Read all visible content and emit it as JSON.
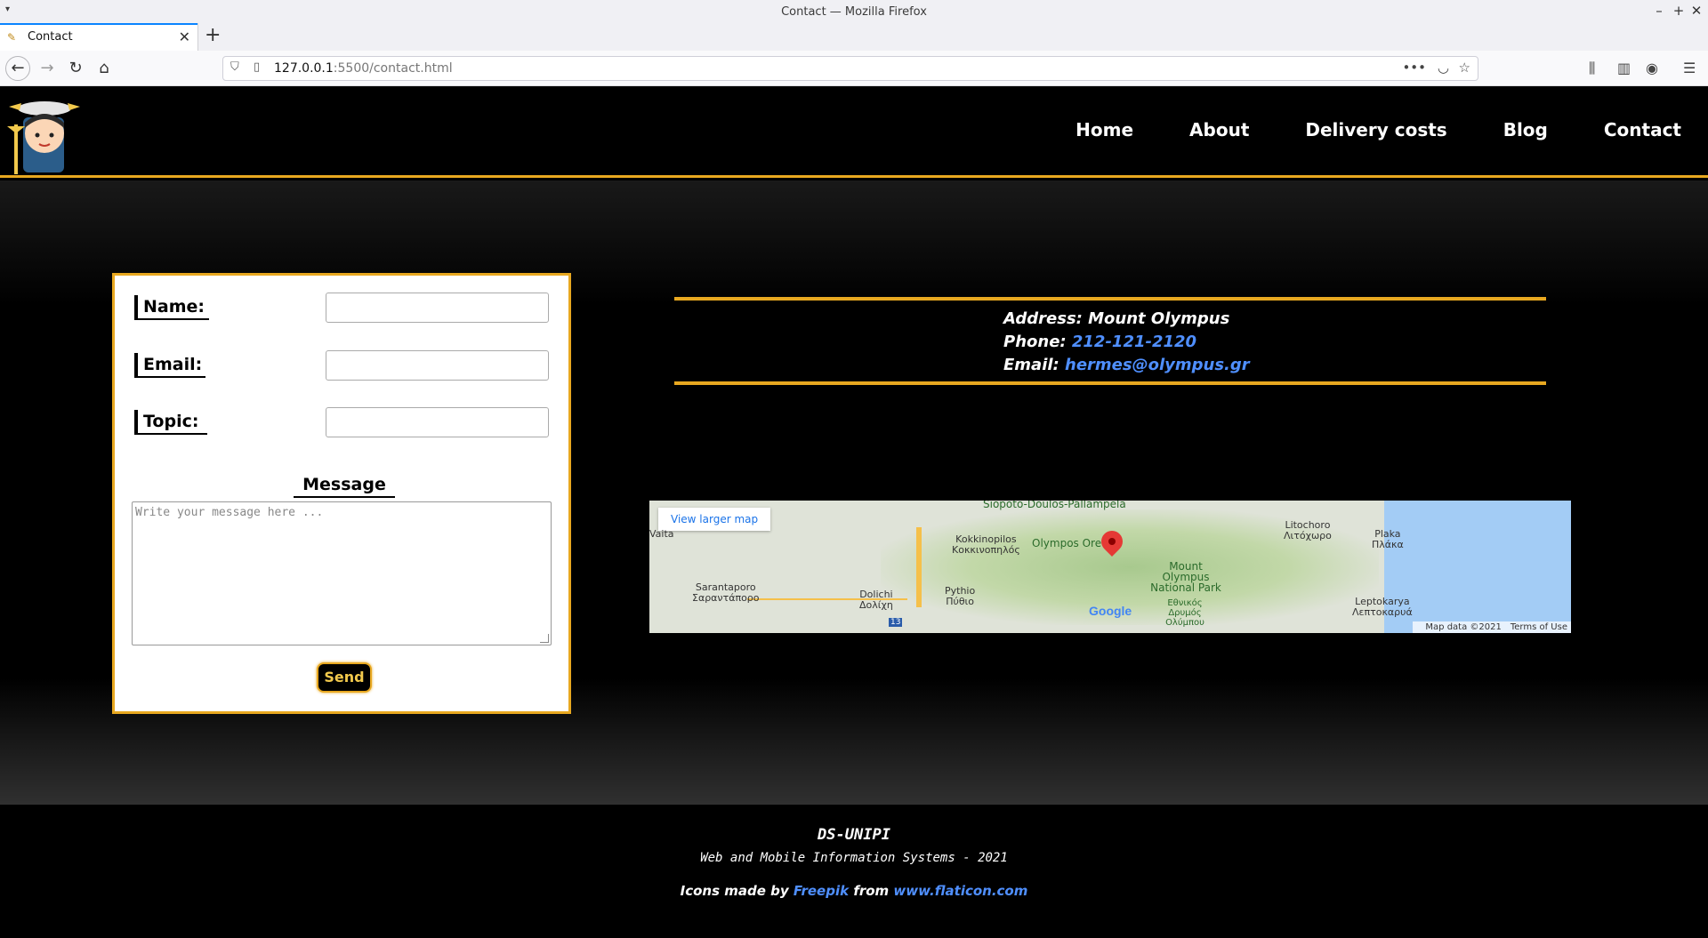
{
  "browser": {
    "window_title": "Contact — Mozilla Firefox",
    "tab_title": "Contact",
    "url_host": "127.0.0.1",
    "url_rest": ":5500/contact.html"
  },
  "site": {
    "nav": [
      "Home",
      "About",
      "Delivery costs",
      "Blog",
      "Contact"
    ]
  },
  "form": {
    "name_label": "Name:",
    "email_label": "Email:",
    "topic_label": "Topic:",
    "message_title": "Message",
    "message_placeholder": "Write your message here ...",
    "send_label": "Send"
  },
  "contact": {
    "address_label": "Address:",
    "address_value": "Mount Olympus",
    "phone_label": "Phone:",
    "phone_value": "212-121-2120",
    "email_label": "Email:",
    "email_value": "hermes@olympus.gr"
  },
  "map": {
    "view_larger": "View larger map",
    "labels": {
      "siopoto": "Siopoto-Doulos-Pallampela",
      "vaita": "Vaita",
      "kokkinopilos": "Kokkinopilos",
      "kokkinopilos_gr": "Κοκκινοπηλός",
      "olympos_ore": "Olympos Ore",
      "litochoro": "Litochoro",
      "litochoro_gr": "Λιτόχωρο",
      "plaka": "Plaka",
      "plaka_gr": "Πλάκα",
      "sarantaporo": "Sarantaporo",
      "sarantaporo_gr": "Σαραντάπορο",
      "dolichi": "Dolichi",
      "dolichi_gr": "Δολίχη",
      "pythio": "Pythio",
      "pythio_gr": "Πύθιο",
      "park": "Mount Olympus National Park",
      "park_gr": "Εθνικός Δρυμός Ολύμπου",
      "leptokarya": "Leptokarya",
      "leptokarya_gr": "Λεπτοκαρυά",
      "route": "13"
    },
    "google": "Google",
    "map_data": "Map data ©2021",
    "terms": "Terms of Use"
  },
  "footer": {
    "brand": "DS-UNIPI",
    "subtitle": "Web and Mobile Information Systems - 2021",
    "credit_prefix": "Icons made by",
    "credit_author": "Freepik",
    "credit_from": "from",
    "credit_site": "www.flaticon.com"
  }
}
